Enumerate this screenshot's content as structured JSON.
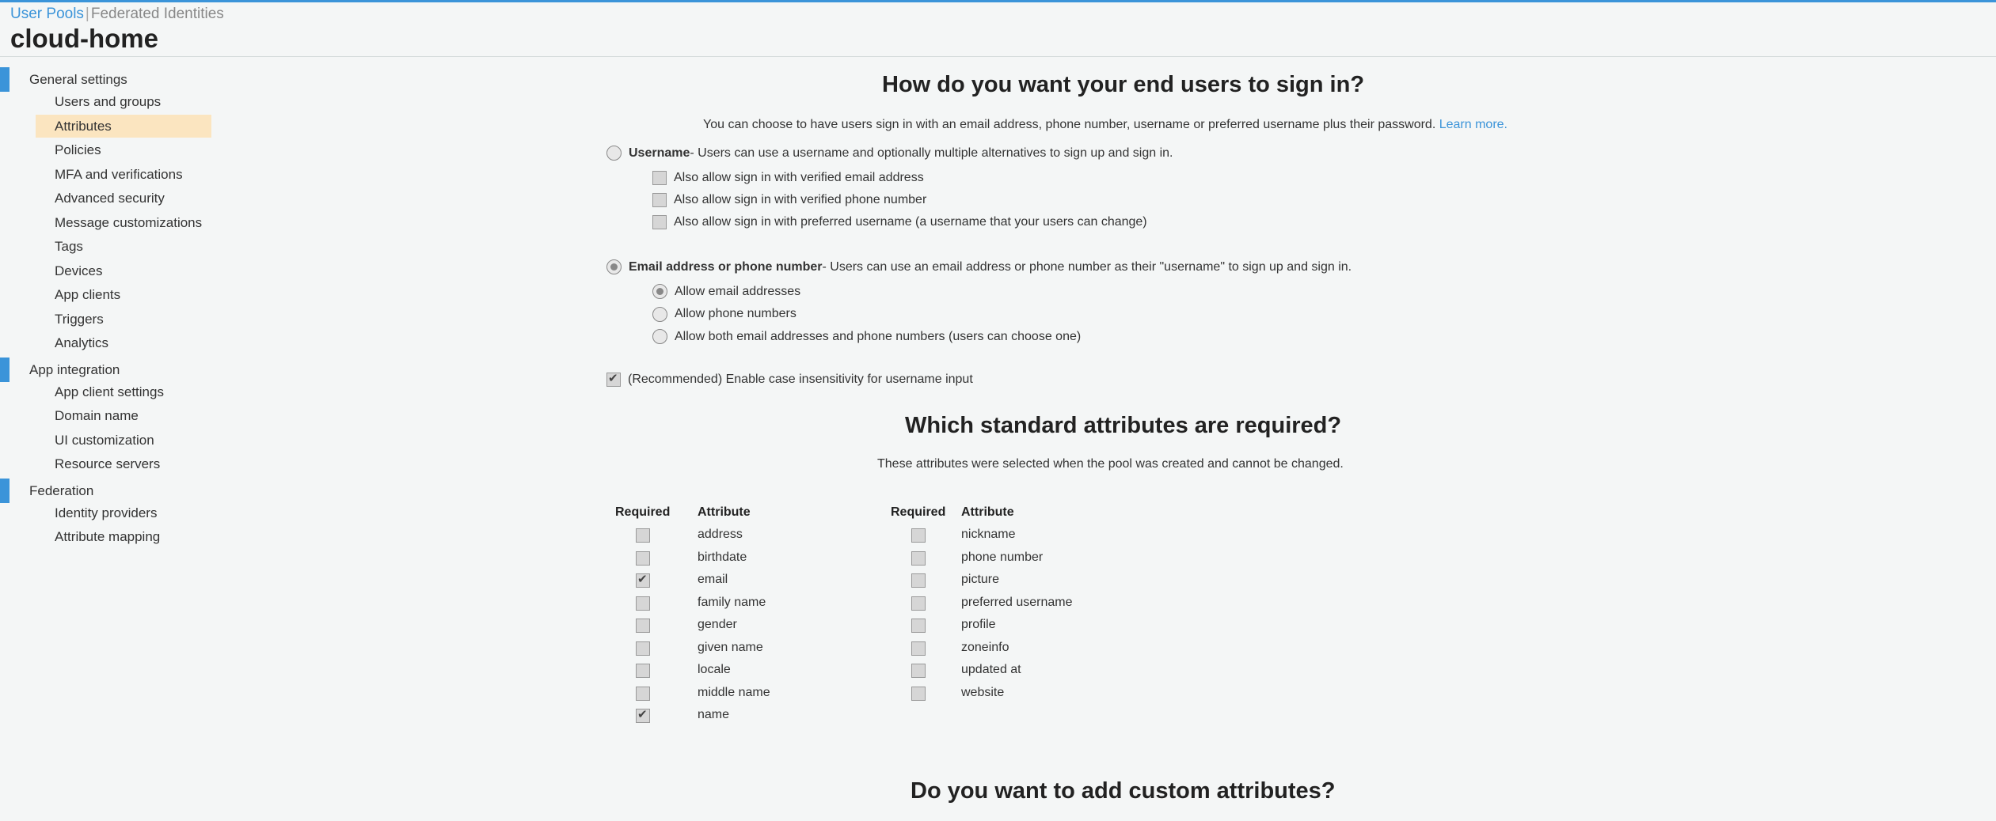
{
  "breadcrumb": {
    "user_pools": "User Pools",
    "federated": "Federated Identities"
  },
  "pool_name": "cloud-home",
  "sidebar": {
    "sections": [
      {
        "label": "General settings",
        "items": [
          "Users and groups",
          "Attributes",
          "Policies",
          "MFA and verifications",
          "Advanced security",
          "Message customizations",
          "Tags",
          "Devices",
          "App clients",
          "Triggers",
          "Analytics"
        ]
      },
      {
        "label": "App integration",
        "items": [
          "App client settings",
          "Domain name",
          "UI customization",
          "Resource servers"
        ]
      },
      {
        "label": "Federation",
        "items": [
          "Identity providers",
          "Attribute mapping"
        ]
      }
    ],
    "active_item": "Attributes"
  },
  "signin": {
    "heading": "How do you want your end users to sign in?",
    "intro": "You can choose to have users sign in with an email address, phone number, username or preferred username plus their password.",
    "learn_more": "Learn more.",
    "username_label": "Username",
    "username_desc": " - Users can use a username and optionally multiple alternatives to sign up and sign in.",
    "username_options": [
      "Also allow sign in with verified email address",
      "Also allow sign in with verified phone number",
      "Also allow sign in with preferred username (a username that your users can change)"
    ],
    "email_label": "Email address or phone number",
    "email_desc": " - Users can use an email address or phone number as their \"username\" to sign up and sign in.",
    "email_options": [
      "Allow email addresses",
      "Allow phone numbers",
      "Allow both email addresses and phone numbers (users can choose one)"
    ],
    "selected_email_option": "Allow email addresses",
    "case_insensitive_label": "(Recommended) Enable case insensitivity for username input"
  },
  "standard": {
    "heading": "Which standard attributes are required?",
    "note": "These attributes were selected when the pool was created and cannot be changed.",
    "col_required": "Required",
    "col_attribute": "Attribute",
    "left": [
      {
        "name": "address",
        "required": false
      },
      {
        "name": "birthdate",
        "required": false
      },
      {
        "name": "email",
        "required": true
      },
      {
        "name": "family name",
        "required": false
      },
      {
        "name": "gender",
        "required": false
      },
      {
        "name": "given name",
        "required": false
      },
      {
        "name": "locale",
        "required": false
      },
      {
        "name": "middle name",
        "required": false
      },
      {
        "name": "name",
        "required": true
      }
    ],
    "right": [
      {
        "name": "nickname",
        "required": false
      },
      {
        "name": "phone number",
        "required": false
      },
      {
        "name": "picture",
        "required": false
      },
      {
        "name": "preferred username",
        "required": false
      },
      {
        "name": "profile",
        "required": false
      },
      {
        "name": "zoneinfo",
        "required": false
      },
      {
        "name": "updated at",
        "required": false
      },
      {
        "name": "website",
        "required": false
      }
    ]
  },
  "custom": {
    "heading": "Do you want to add custom attributes?"
  }
}
